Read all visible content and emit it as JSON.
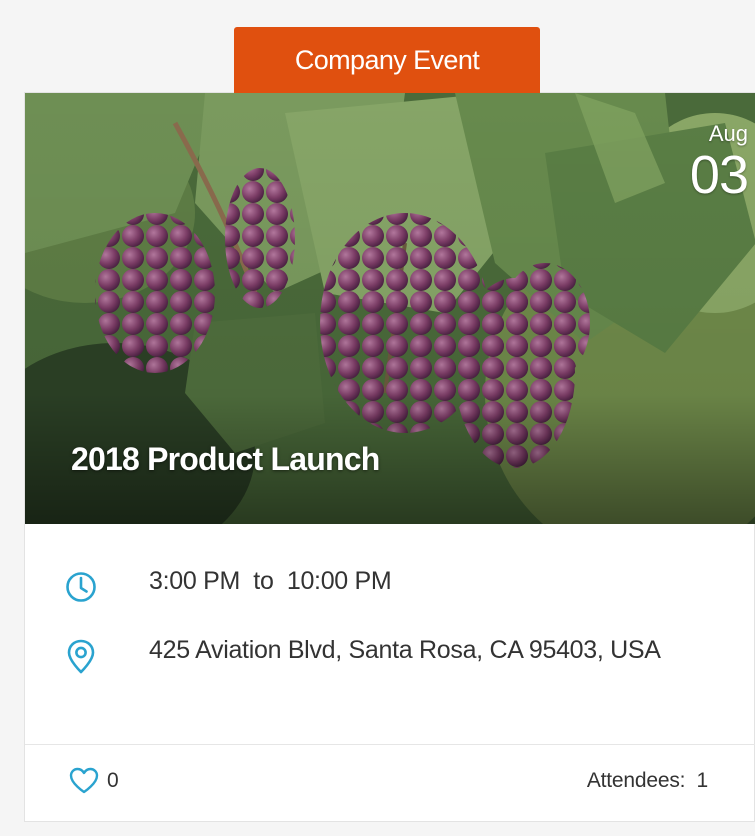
{
  "event": {
    "category": "Company Event",
    "date": {
      "month": "Aug",
      "day": "03"
    },
    "title": "2018 Product Launch",
    "time": {
      "start": "3:00 PM",
      "separator": "to",
      "end": "10:00 PM",
      "display": "3:00 PM  to  10:00 PM"
    },
    "location": "425 Aviation Blvd, Santa Rosa, CA 95403, USA"
  },
  "footer": {
    "likes": "0",
    "attendees_label": "Attendees:",
    "attendees_count": "1",
    "attendees_display": "Attendees:  1"
  },
  "icons": {
    "clock": "clock-icon",
    "location": "map-pin-icon",
    "like": "heart-outline-icon"
  },
  "colors": {
    "tag_background": "#e0500f",
    "icon_accent": "#2aa3cf",
    "text": "#333333",
    "page_background": "#f5f5f5"
  }
}
